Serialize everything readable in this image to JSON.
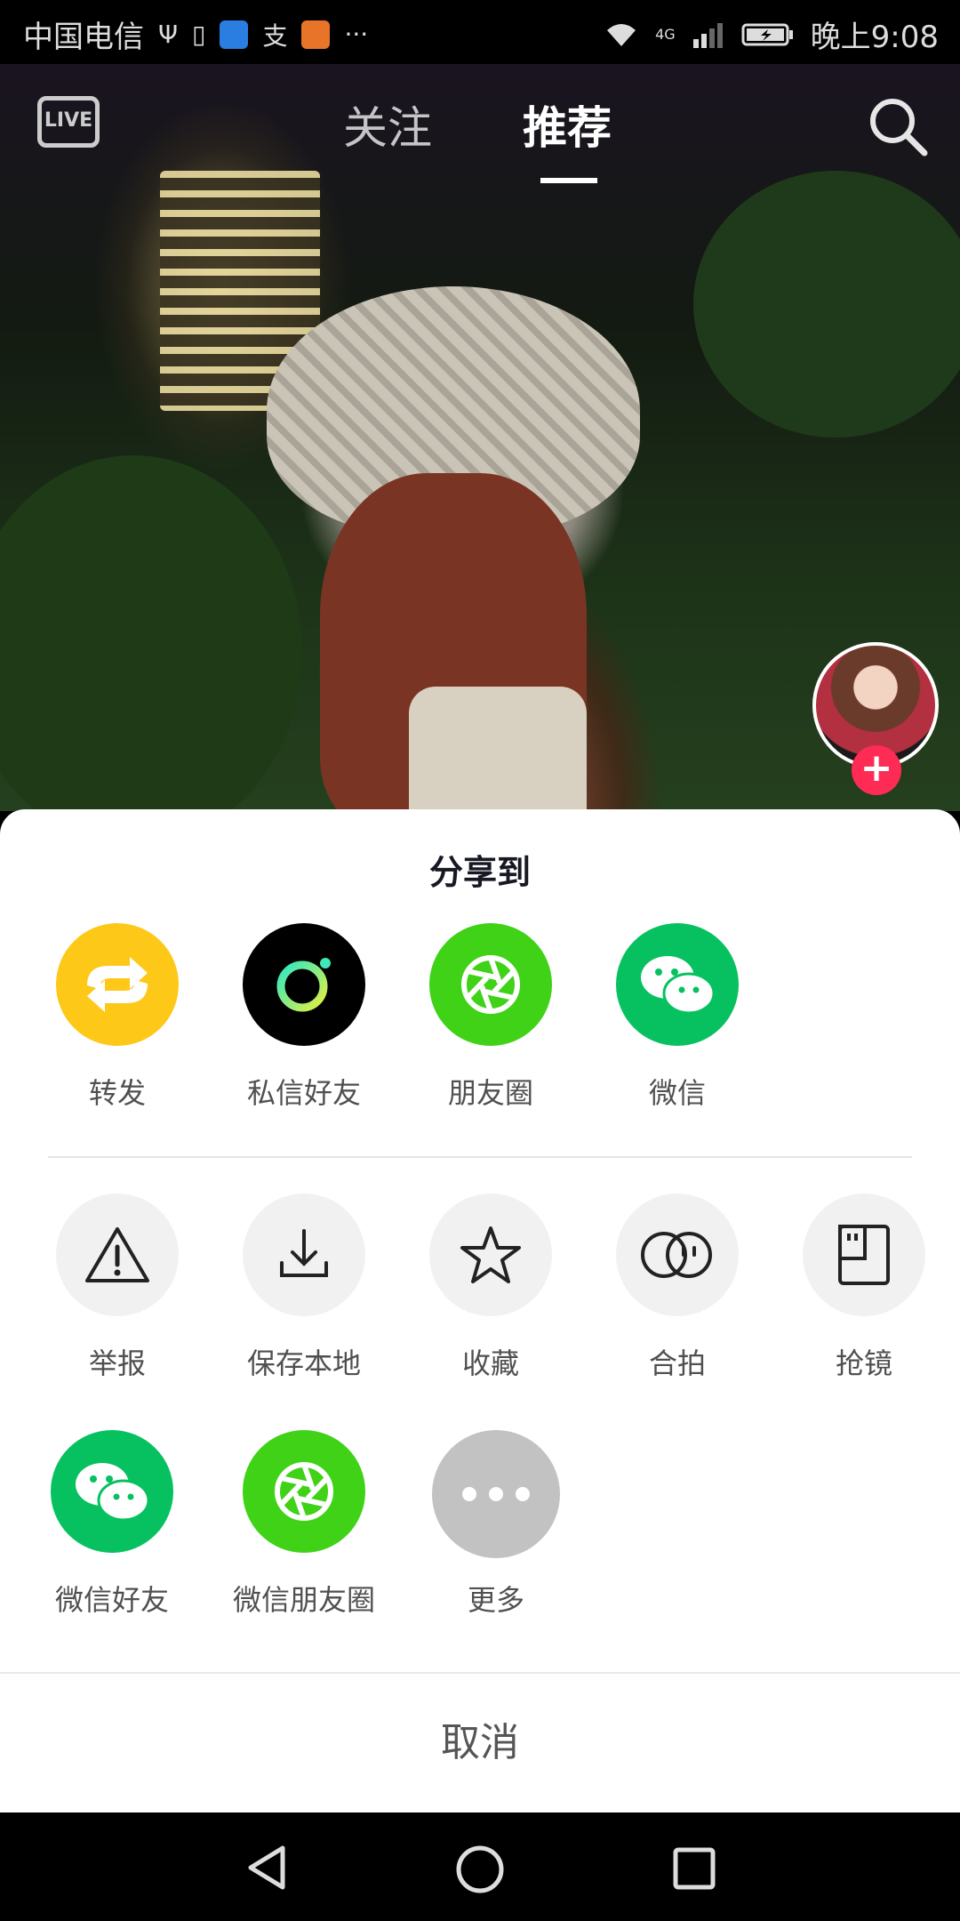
{
  "status_bar": {
    "carrier": "中国电信",
    "network": "4G",
    "time_label": "晚上9:08",
    "app_icons": [
      "usb-icon",
      "sim-icon",
      "heart-app-icon",
      "zhi-app-icon",
      "heart-app-icon-orange",
      "more-dots-icon"
    ]
  },
  "top_nav": {
    "live_label": "LIVE",
    "tabs": [
      {
        "label": "关注",
        "active": false
      },
      {
        "label": "推荐",
        "active": true
      }
    ]
  },
  "share_sheet": {
    "title": "分享到",
    "row1": [
      {
        "label": "转发",
        "icon": "repost-icon",
        "color": "#fdc818"
      },
      {
        "label": "私信好友",
        "icon": "message-friend-icon",
        "color": "#000000"
      },
      {
        "label": "朋友圈",
        "icon": "moments-icon",
        "color": "#3fd216"
      },
      {
        "label": "微信",
        "icon": "wechat-icon",
        "color": "#07c160"
      }
    ],
    "row2": [
      {
        "label": "举报",
        "icon": "warning-icon"
      },
      {
        "label": "保存本地",
        "icon": "download-icon"
      },
      {
        "label": "收藏",
        "icon": "star-icon"
      },
      {
        "label": "合拍",
        "icon": "duet-icon"
      },
      {
        "label": "抢镜",
        "icon": "reaction-icon"
      }
    ],
    "row3": [
      {
        "label": "微信好友",
        "icon": "wechat-icon",
        "color": "#07c160"
      },
      {
        "label": "微信朋友圈",
        "icon": "moments-icon",
        "color": "#3fd216"
      },
      {
        "label": "更多",
        "icon": "more-icon",
        "color": "#c2c2c2"
      }
    ],
    "cancel_label": "取消"
  }
}
